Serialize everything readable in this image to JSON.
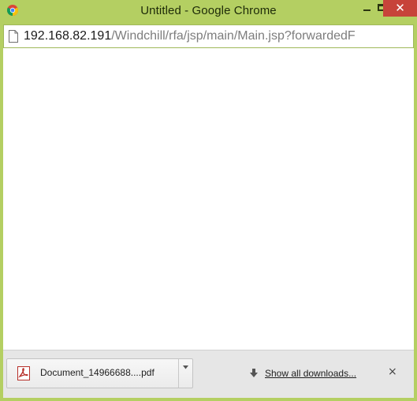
{
  "window": {
    "title": "Untitled - Google Chrome",
    "frame_color": "#b4cf62",
    "close_color": "#c7433a",
    "minimize_glyph": "–",
    "close_glyph": "✕"
  },
  "addressbar": {
    "icon": "page-icon",
    "url_host": "192.168.82.191",
    "url_path": "/Windchill/rfa/jsp/main/Main.jsp?forwardedF"
  },
  "downloads": {
    "item": {
      "icon": "pdf-icon",
      "filename": "Document_14966688....pdf",
      "menu_icon": "dropdown-arrow-icon"
    },
    "show_all_icon": "download-arrow-icon",
    "show_all_label": "Show all downloads...",
    "close_glyph": "×"
  }
}
